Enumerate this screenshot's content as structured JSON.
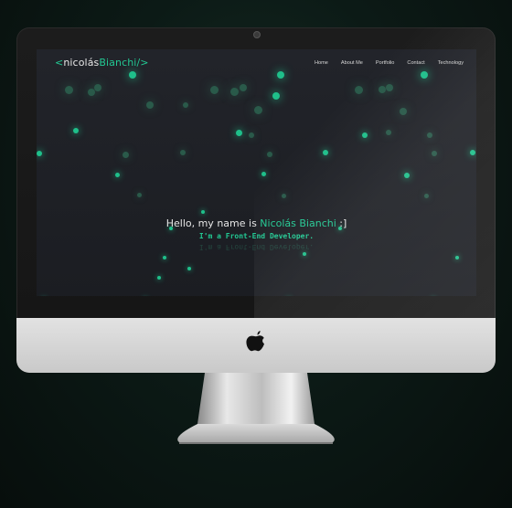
{
  "logo": {
    "open": "<",
    "first": "nicolás",
    "last": "Bianchi",
    "close": "/>"
  },
  "nav": [
    "Home",
    "About Me",
    "Portfolio",
    "Contact",
    "Technology"
  ],
  "hero": {
    "greeting": "Hello, my name is ",
    "name": "Nicolás Bianchi",
    "suffix": " :]",
    "subtitle": "I'm a Front-End Developer.",
    "reflection": "I'm a Front-End Developer."
  },
  "colors": {
    "accent": "#22c993",
    "background": "#1b1d22"
  },
  "icons": {
    "brand": "apple-logo-icon",
    "camera": "camera-icon"
  }
}
